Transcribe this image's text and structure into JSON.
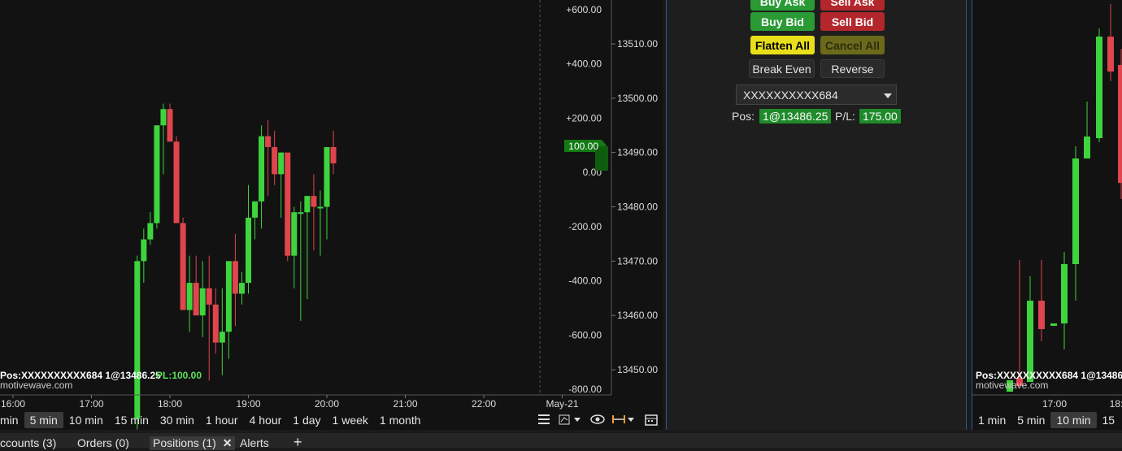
{
  "left_chart": {
    "pl_axis_labels": [
      "+600.00",
      "+400.00",
      "+200.00",
      "0.00",
      "-200.00",
      "-400.00",
      "-600.00",
      "-800.00"
    ],
    "pl_marker": "100.00",
    "price_axis_labels": [
      "13510.00",
      "13500.00",
      "13490.00",
      "13480.00",
      "13470.00",
      "13460.00",
      "13450.00"
    ],
    "time_labels": [
      "16:00",
      "17:00",
      "18:00",
      "19:00",
      "20:00",
      "21:00",
      "22:00",
      "May-21"
    ],
    "position_info": "Pos:XXXXXXXXXX684 1@13486.25",
    "pl_info": "PL:100.00",
    "watermark": "motivewave.com",
    "timeframes": [
      "min",
      "5 min",
      "10 min",
      "15 min",
      "30 min",
      "1 hour",
      "4 hour",
      "1 day",
      "1 week",
      "1 month"
    ],
    "selected_timeframe": "5 min"
  },
  "trade_panel": {
    "buy_ask": "Buy Ask",
    "sell_ask": "Sell Ask",
    "buy_bid": "Buy Bid",
    "sell_bid": "Sell Bid",
    "flatten_all": "Flatten All",
    "cancel_all": "Cancel All",
    "break_even": "Break Even",
    "reverse": "Reverse",
    "account": "XXXXXXXXXX684",
    "pos_label": "Pos:",
    "pos_value": "1@13486.25",
    "pl_label": "P/L:",
    "pl_value": "175.00"
  },
  "right_chart": {
    "position_info": "Pos:XXXXXXXXXX684 1@13486",
    "watermark": "motivewave.com",
    "time_labels": [
      "17:00",
      "18:"
    ],
    "timeframes": [
      "1 min",
      "5 min",
      "10 min",
      "15"
    ],
    "selected_timeframe": "10 min"
  },
  "bottom_tabs": {
    "accounts": "ccounts (3)",
    "orders": "Orders (0)",
    "positions": "Positions (1)",
    "alerts": "Alerts",
    "add": "+"
  },
  "colors": {
    "up": "#3ed43e",
    "down": "#e0454d",
    "panel_border": "#2f5a8a"
  },
  "chart_data": {
    "type": "candlestick",
    "x_start": "17:35",
    "interval_minutes": 5,
    "ohlc": [
      [
        13441,
        13471,
        13439,
        13470
      ],
      [
        13470,
        13476,
        13466,
        13474
      ],
      [
        13474,
        13479,
        13473,
        13477
      ],
      [
        13477,
        13495,
        13476,
        13495
      ],
      [
        13495,
        13499,
        13486,
        13498
      ],
      [
        13498,
        13499,
        13493,
        13492
      ],
      [
        13492,
        13493,
        13477,
        13477
      ],
      [
        13477,
        13478,
        13461,
        13461
      ],
      [
        13461,
        13471,
        13457,
        13466
      ],
      [
        13466,
        13471,
        13460,
        13460
      ],
      [
        13460,
        13470,
        13456,
        13465
      ],
      [
        13465,
        13471,
        13448,
        13462
      ],
      [
        13462,
        13465,
        13453,
        13455
      ],
      [
        13455,
        13465,
        13449,
        13457
      ],
      [
        13457,
        13466,
        13452,
        13470
      ],
      [
        13470,
        13475,
        13458,
        13464
      ],
      [
        13464,
        13468,
        13462,
        13466
      ],
      [
        13466,
        13484,
        13464,
        13478
      ],
      [
        13478,
        13481,
        13474,
        13481
      ],
      [
        13481,
        13495,
        13476,
        13493
      ],
      [
        13493,
        13496,
        13482,
        13491
      ],
      [
        13491,
        13494,
        13484,
        13486
      ],
      [
        13486,
        13490,
        13478,
        13490
      ],
      [
        13490,
        13484,
        13470,
        13471
      ],
      [
        13471,
        13480,
        13465,
        13479
      ],
      [
        13479,
        13481,
        13459,
        13479
      ],
      [
        13479,
        13482,
        13463,
        13482
      ],
      [
        13482,
        13486,
        13472,
        13480
      ],
      [
        13480,
        13483,
        13471,
        13480
      ],
      [
        13480,
        13484,
        13474,
        13491
      ],
      [
        13491,
        13494,
        13486,
        13488
      ]
    ]
  }
}
